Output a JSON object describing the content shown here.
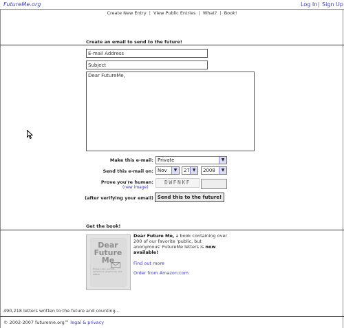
{
  "header": {
    "logo": "FutureMe.org",
    "login": "Log In",
    "separator": "|",
    "signup": "Sign Up"
  },
  "nav": {
    "items": [
      "Create New Entry",
      "View Public Entries",
      "What?",
      "Book!"
    ],
    "separator": "|"
  },
  "compose": {
    "heading": "Create an email to send to the future!",
    "email_value": "E-mail Address",
    "subject_value": "Subject",
    "body_value": "Dear FutureMe,",
    "make_label": "Make this e-mail:",
    "privacy_value": "Private",
    "send_label": "Send this e-mail on:",
    "month_value": "Nov",
    "day_value": "27",
    "year_value": "2008",
    "prove_label": "Prove you're human:",
    "new_image": "(new image)",
    "captcha_text": "DWFNKF",
    "after_label": "(after verifying your email)",
    "send_button": "Send this to the future!"
  },
  "book": {
    "heading": "Get the book!",
    "cover_title": "Dear Future Me",
    "cover_subtitle": "Hopes, fears, secrets, resolutions, prophecies, and advice",
    "desc_bold": "Dear Future Me,",
    "desc_text": " a book containing over 200 of our favorite 'public, but anonymous' FutureMe letters is ",
    "desc_bold2": "now available!",
    "find_out": "Find out more",
    "order": "Order from Amazon.com"
  },
  "footer": {
    "count": "490,218 letters written to the future and counting...",
    "copyright": "© 2002-2007 futureme.org™ ",
    "legal": "legal & privacy"
  },
  "colors": {
    "link": "#3a3aa8",
    "divider": "#333333"
  },
  "icons": {
    "dropdown": "chevron-down-icon",
    "cursor": "mouse-pointer-icon",
    "envelope": "envelope-icon"
  }
}
